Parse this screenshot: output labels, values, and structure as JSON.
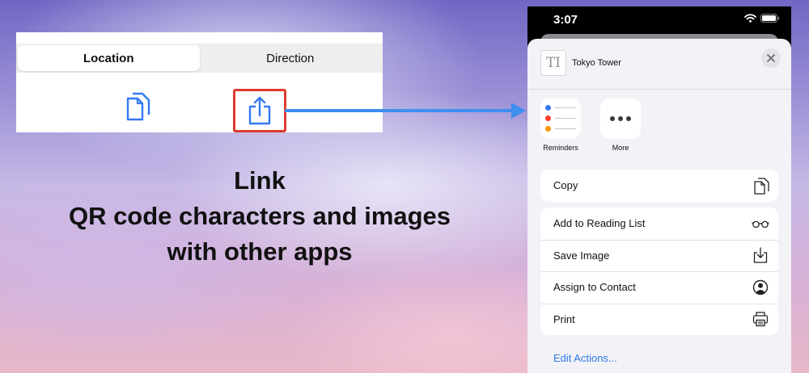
{
  "segmented": {
    "tabs": [
      {
        "label": "Location",
        "active": true
      },
      {
        "label": "Direction",
        "active": false
      }
    ]
  },
  "toolbar": {
    "copy_icon": "copy-documents-icon",
    "share_icon": "share-icon",
    "accent_color": "#3478f6",
    "highlight_color": "#e03a2e"
  },
  "caption": {
    "line1": "Link",
    "line2": "QR code characters and images",
    "line3": "with other apps"
  },
  "phone": {
    "status": {
      "time": "3:07"
    },
    "share_sheet": {
      "item_title": "Tokyo Tower",
      "thumbnail_glyph": "TI",
      "apps": [
        {
          "label": "Reminders",
          "icon": "reminders-icon"
        },
        {
          "label": "More",
          "icon": "more-icon"
        }
      ],
      "copy_action": {
        "label": "Copy",
        "icon": "copy-icon"
      },
      "actions": [
        {
          "label": "Add to Reading List",
          "icon": "glasses-icon"
        },
        {
          "label": "Save Image",
          "icon": "save-image-icon"
        },
        {
          "label": "Assign to Contact",
          "icon": "contact-icon"
        },
        {
          "label": "Print",
          "icon": "printer-icon"
        }
      ],
      "edit_actions": "Edit Actions..."
    }
  }
}
